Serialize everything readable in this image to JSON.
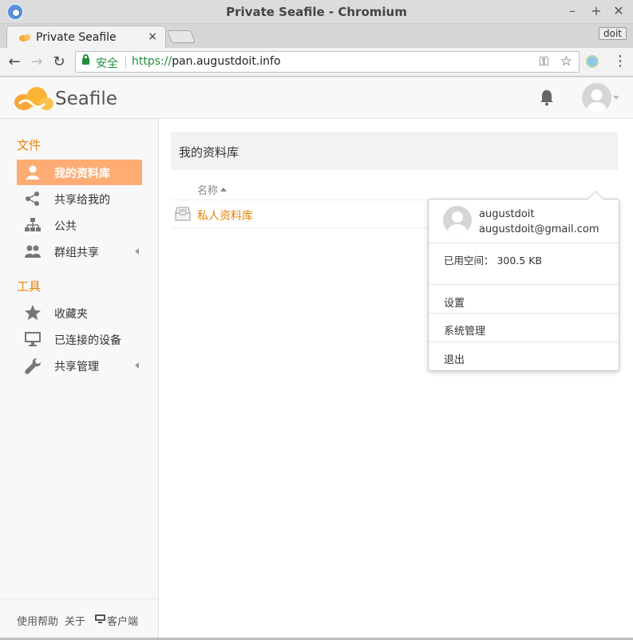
{
  "window": {
    "title": "Private Seafile - Chromium"
  },
  "tab": {
    "title": "Private Seafile",
    "close": "×"
  },
  "profile_chip": "doit",
  "address": {
    "secure_label": "安全",
    "scheme": "https://",
    "host": "pan.augustdoit.info"
  },
  "header": {
    "logo_text_a": "Sea",
    "logo_text_b": "file"
  },
  "sidebar": {
    "files_heading": "文件",
    "files_items": [
      {
        "label": "我的资料库",
        "icon": "user-icon",
        "active": true
      },
      {
        "label": "共享给我的",
        "icon": "share-icon"
      },
      {
        "label": "公共",
        "icon": "sitemap-icon"
      },
      {
        "label": "群组共享",
        "icon": "group-icon",
        "expandable": true
      }
    ],
    "tools_heading": "工具",
    "tools_items": [
      {
        "label": "收藏夹",
        "icon": "star-icon"
      },
      {
        "label": "已连接的设备",
        "icon": "monitor-icon"
      },
      {
        "label": "共享管理",
        "icon": "wrench-icon",
        "expandable": true
      }
    ],
    "footer": {
      "help": "使用帮助",
      "about": "关于",
      "client": "客户端"
    }
  },
  "main": {
    "title": "我的资料库",
    "column_name": "名称",
    "libraries": [
      {
        "name": "私人资料库"
      }
    ]
  },
  "user_menu": {
    "username": "augustdoit",
    "email": "augustdoit@gmail.com",
    "space_used": "已用空间：  300.5 KB",
    "items": [
      "设置",
      "系统管理",
      "退出"
    ]
  },
  "colors": {
    "accent": "#eb8205",
    "active_item": "#feac74",
    "secure_green": "#1e8e3e"
  }
}
